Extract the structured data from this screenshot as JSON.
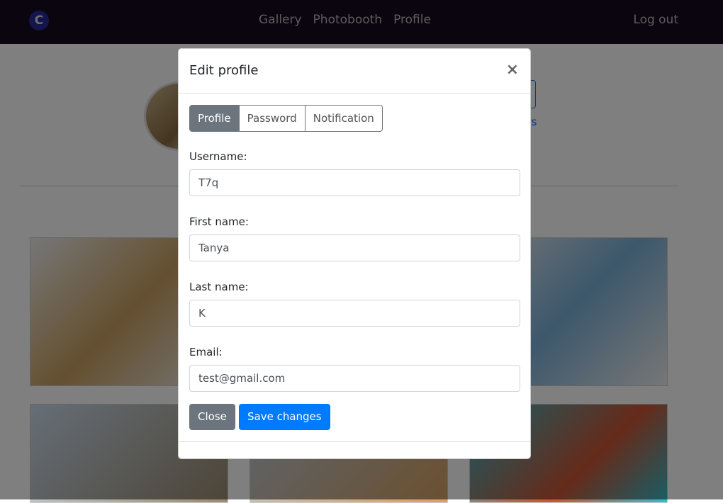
{
  "nav": {
    "logo": "C",
    "links": [
      "Gallery",
      "Photobooth",
      "Profile"
    ],
    "logout": "Log out"
  },
  "background": {
    "followers_link": "followers"
  },
  "modal": {
    "title": "Edit profile",
    "close_icon": "×",
    "tabs": [
      {
        "label": "Profile",
        "active": true
      },
      {
        "label": "Password",
        "active": false
      },
      {
        "label": "Notification",
        "active": false
      }
    ],
    "fields": [
      {
        "label": "Username:",
        "value": "T7q"
      },
      {
        "label": "First name:",
        "value": "Tanya"
      },
      {
        "label": "Last name:",
        "value": "K"
      },
      {
        "label": "Email:",
        "value": "test@gmail.com"
      }
    ],
    "close_button": "Close",
    "save_button": "Save changes"
  },
  "colors": {
    "primary": "#007bff",
    "secondary": "#6c757d",
    "navbar": "#150a1c"
  }
}
